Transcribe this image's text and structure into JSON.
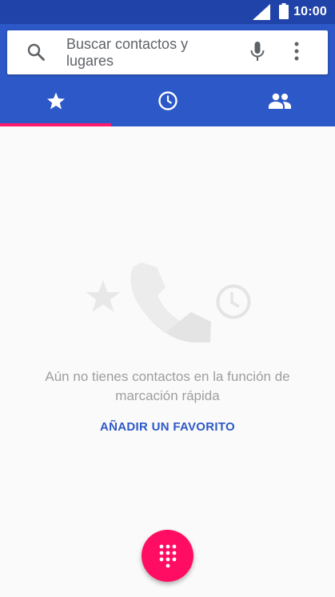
{
  "status_bar": {
    "time": "10:00",
    "icons": [
      "signal-icon",
      "battery-icon"
    ]
  },
  "search": {
    "placeholder": "Buscar contactos y lugares",
    "icons": [
      "search-icon",
      "mic-icon",
      "more-vert-icon"
    ]
  },
  "tabs": [
    {
      "icon": "star-icon",
      "selected": true
    },
    {
      "icon": "clock-icon",
      "selected": false
    },
    {
      "icon": "people-icon",
      "selected": false
    }
  ],
  "empty_state": {
    "message": "Aún no tienes contactos en la función de marcación rápida",
    "action_label": "AÑADIR UN FAVORITO"
  },
  "fab": {
    "icon": "dialpad-icon"
  },
  "colors": {
    "status_bar": "#1f43a8",
    "header": "#2d58c7",
    "tab_indicator": "#ff1a6e",
    "fab": "#ff0d63",
    "accent_text": "#2d58c7"
  }
}
